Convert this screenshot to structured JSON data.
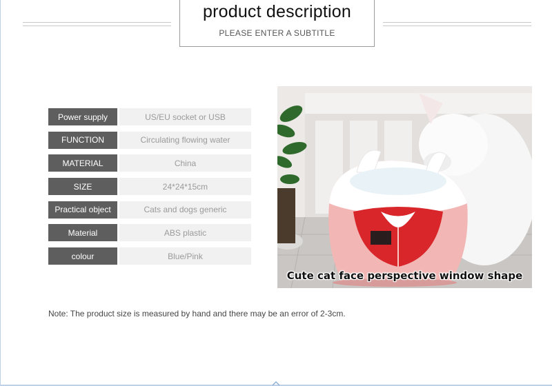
{
  "header": {
    "title": "product description",
    "subtitle": "PLEASE ENTER A SUBTITLE"
  },
  "specs": [
    {
      "label": "Power supply",
      "value": "US/EU socket or USB"
    },
    {
      "label": "FUNCTION",
      "value": "Circulating flowing water"
    },
    {
      "label": "MATERIAL",
      "value": "China"
    },
    {
      "label": "SIZE",
      "value": "24*24*15cm"
    },
    {
      "label": "Practical object",
      "value": "Cats and dogs generic"
    },
    {
      "label": "Material",
      "value": "ABS plastic"
    },
    {
      "label": "colour",
      "value": "Blue/Pink"
    }
  ],
  "photo": {
    "caption": "Cute cat face perspective window shape"
  },
  "note": "Note: The product size is measured by hand and there may be an error of 2-3cm.",
  "colors": {
    "label_bg": "#5e5e5e",
    "value_bg": "#f1f1f1",
    "frame": "#bcd0e8"
  }
}
